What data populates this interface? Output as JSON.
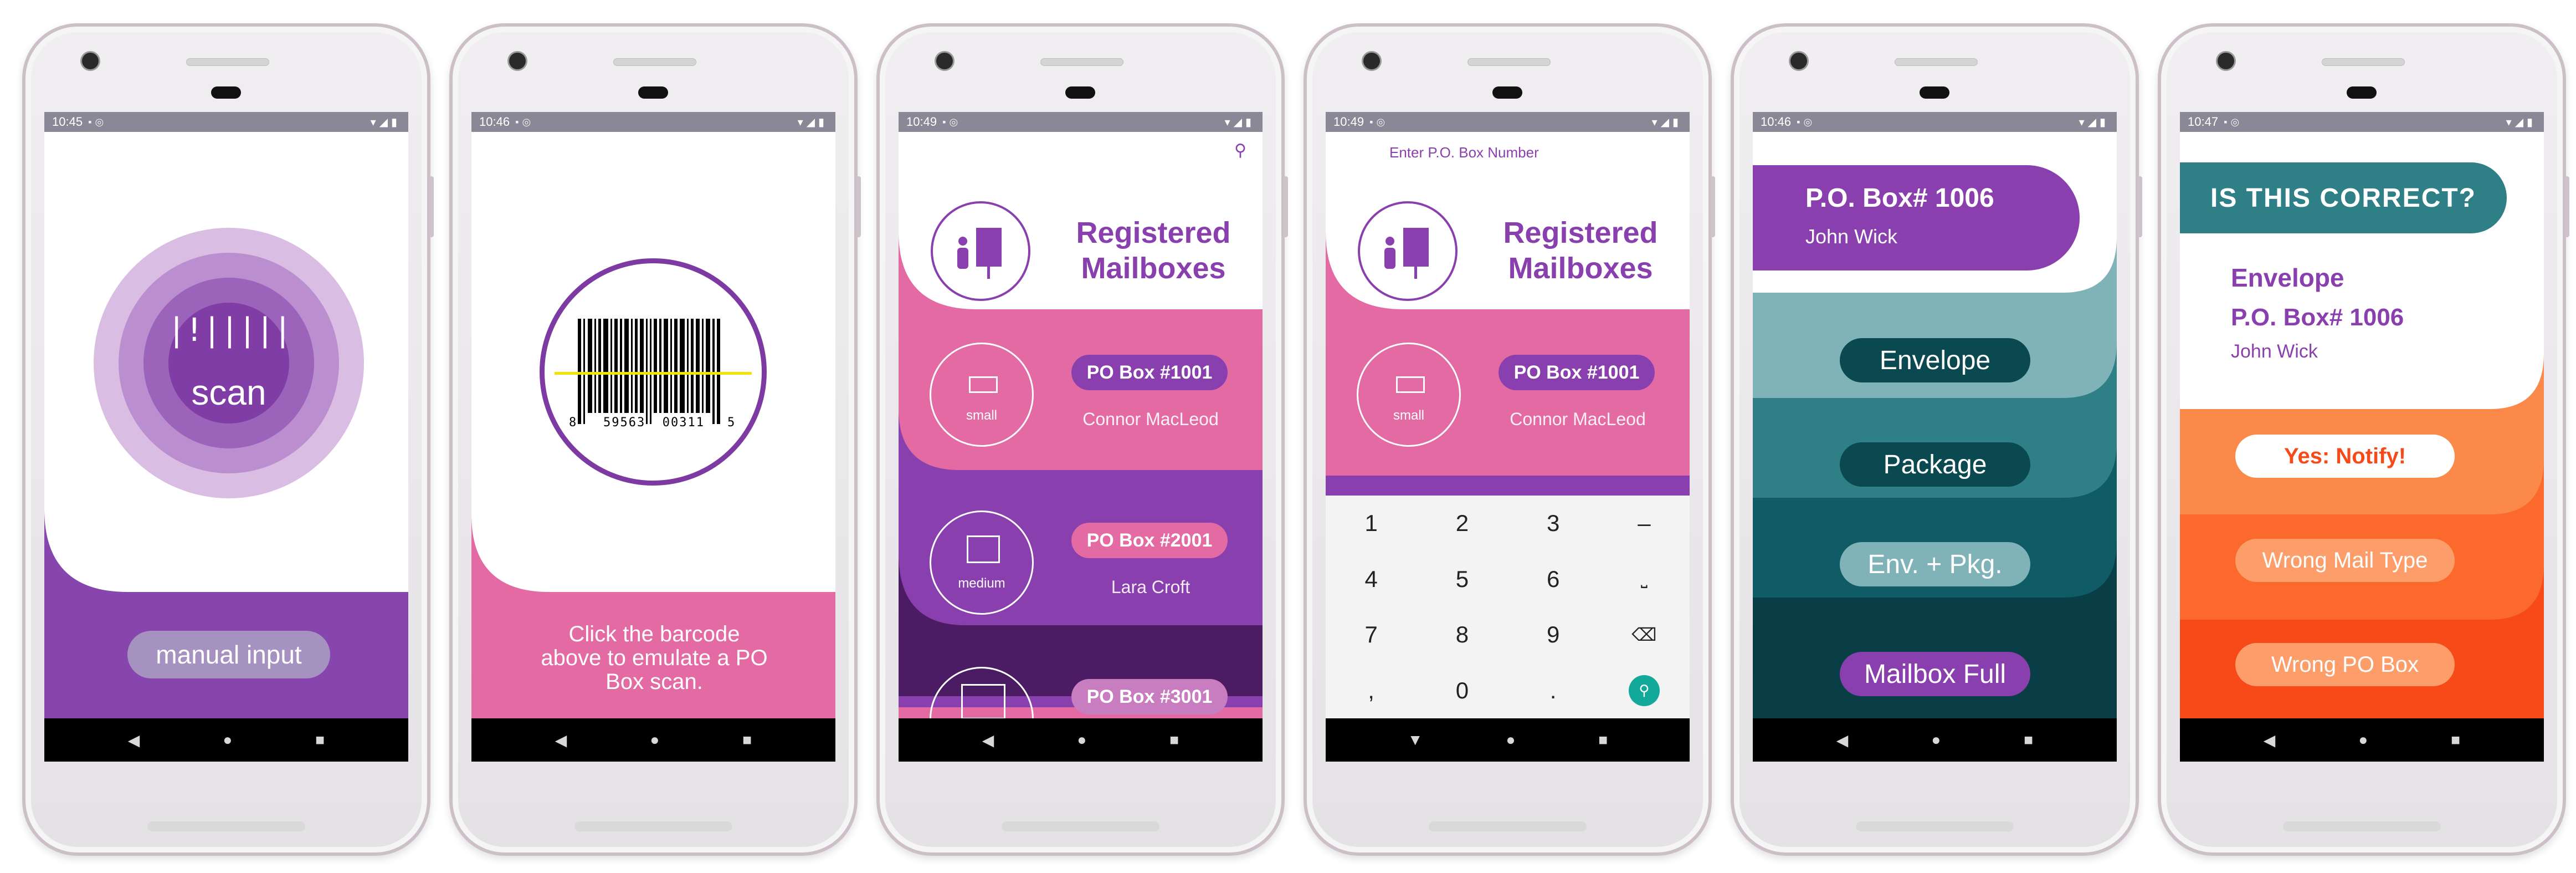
{
  "screens": [
    {
      "time": "10:45",
      "manual_input": "manual input",
      "scan_label": "scan"
    },
    {
      "time": "10:46",
      "barcode_left": "8",
      "barcode_digits": "59563  00311",
      "barcode_right": "5",
      "instructions": "Click the barcode above to emulate a PO Box scan."
    },
    {
      "time": "10:49",
      "title_line1": "Registered",
      "title_line2": "Mailboxes",
      "mailboxes": [
        {
          "size": "small",
          "box": "PO Box #1001",
          "name": "Connor MacLeod"
        },
        {
          "size": "medium",
          "box": "PO Box #2001",
          "name": "Lara Croft"
        },
        {
          "size": "",
          "box": "PO Box #3001",
          "name": ""
        }
      ]
    },
    {
      "time": "10:49",
      "search_placeholder": "Enter P.O. Box Number",
      "title_line1": "Registered",
      "title_line2": "Mailboxes",
      "mailbox": {
        "size": "small",
        "box": "PO Box #1001",
        "name": "Connor MacLeod"
      },
      "keys": [
        "1",
        "2",
        "3",
        "–",
        "4",
        "5",
        "6",
        "⎵",
        "7",
        "8",
        "9",
        "⌫",
        ",",
        "0",
        ".",
        "🔍"
      ]
    },
    {
      "time": "10:46",
      "box": "P.O. Box# 1006",
      "name": "John Wick",
      "options": [
        "Envelope",
        "Package",
        "Env. + Pkg.",
        "Mailbox Full"
      ]
    },
    {
      "time": "10:47",
      "question": "IS THIS CORRECT?",
      "mail_type": "Envelope",
      "box": "P.O. Box# 1006",
      "name": "John Wick",
      "actions": [
        "Yes: Notify!",
        "Wrong Mail Type",
        "Wrong PO Box"
      ]
    }
  ],
  "colors": {
    "purple": "#8746ad",
    "pink": "#e46aa3",
    "teal": "#2e7f86",
    "orange": "#fb6a2c",
    "statusbar": "#8a8797"
  }
}
